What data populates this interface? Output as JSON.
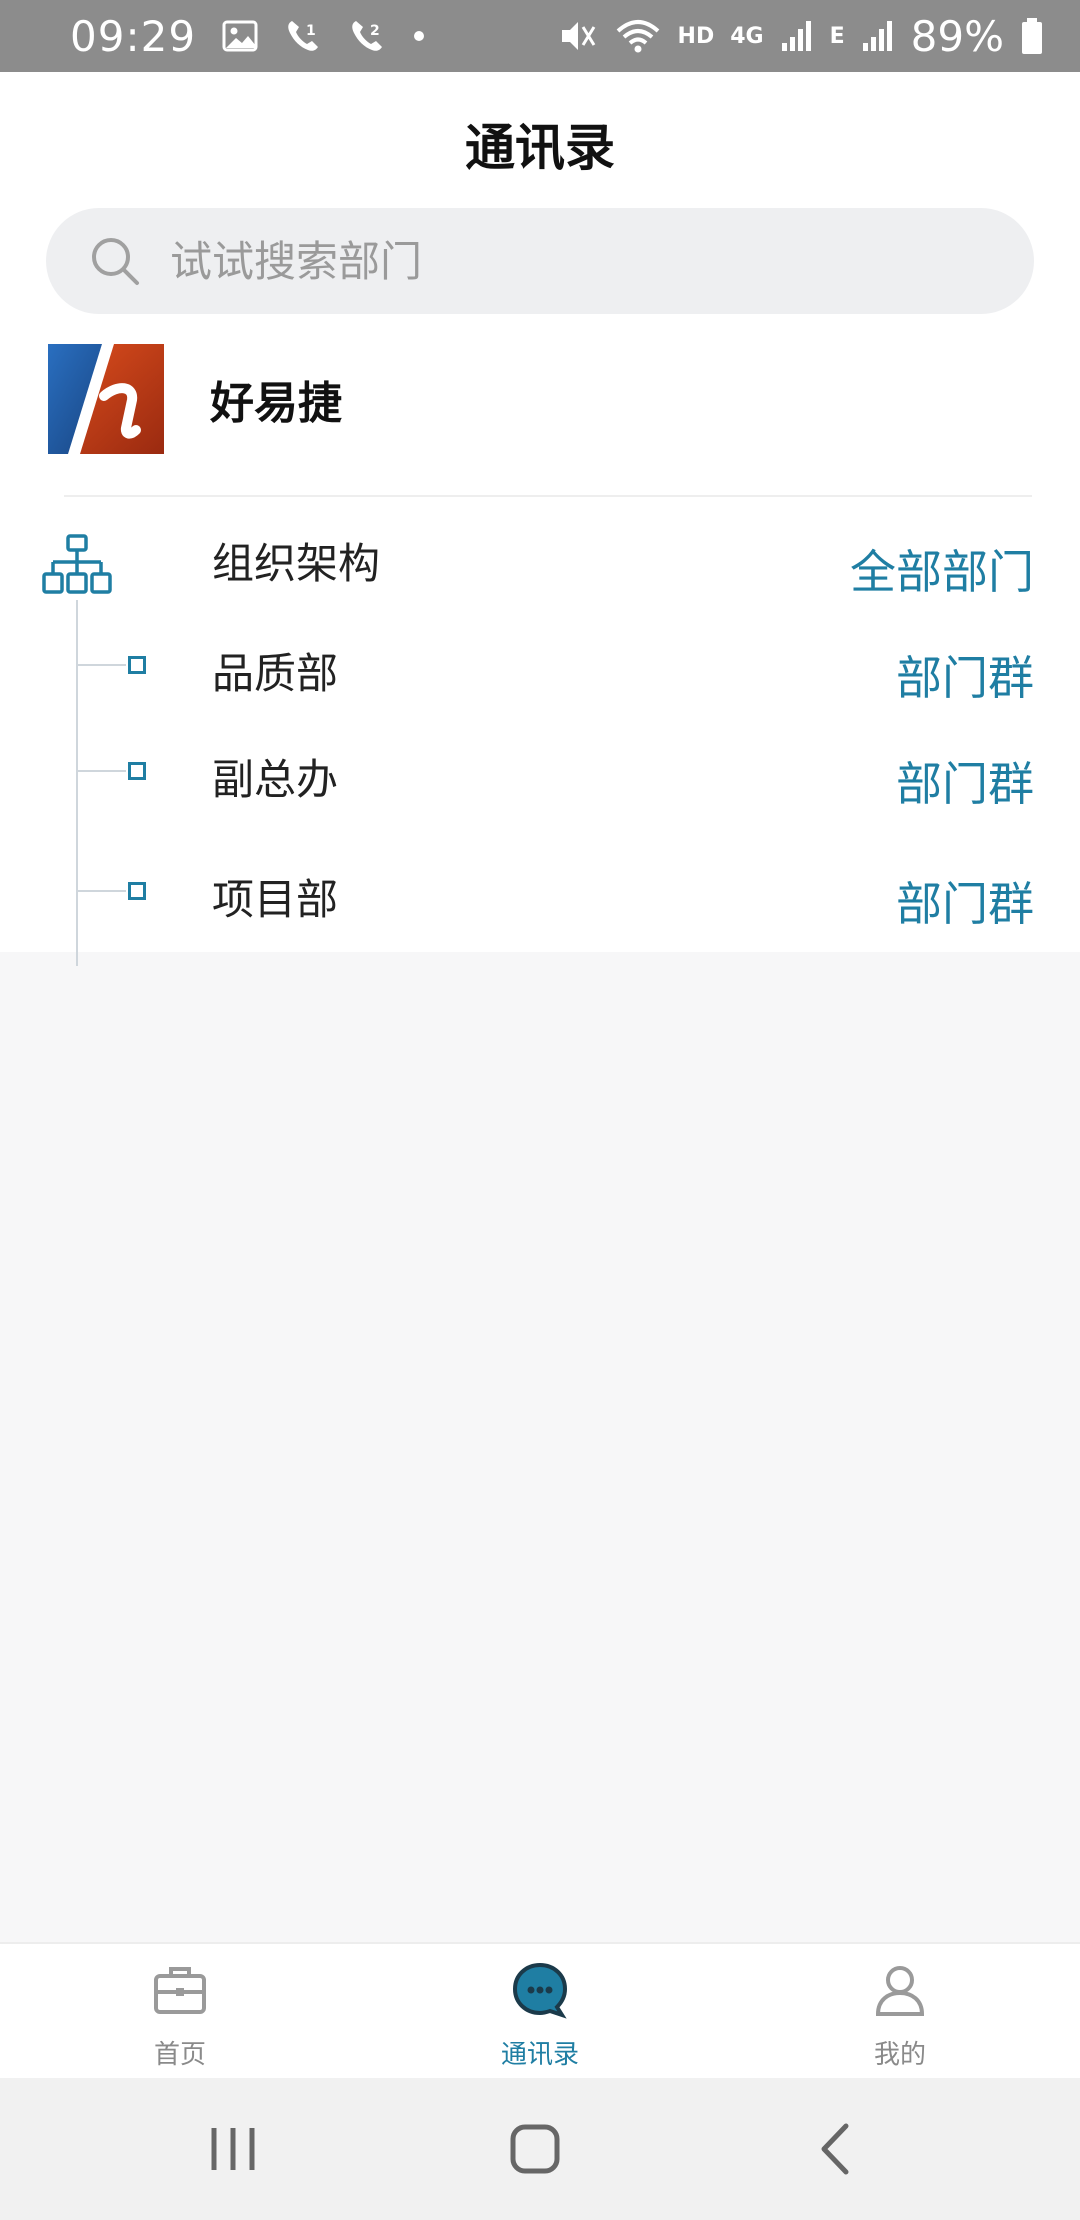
{
  "status_bar": {
    "time": "09:29",
    "network_label": "HD",
    "network_type": "4G",
    "network_sub": "E",
    "battery": "89%"
  },
  "page": {
    "title": "通讯录"
  },
  "search": {
    "placeholder": "试试搜索部门"
  },
  "company": {
    "name": "好易捷",
    "logo_letter": "h",
    "logo_colors": {
      "left": "#1f5aa6",
      "right": "#c8401a"
    }
  },
  "org": {
    "label": "组织架构",
    "all_link": "全部部门",
    "departments": [
      {
        "name": "品质部",
        "action": "部门群"
      },
      {
        "name": "副总办",
        "action": "部门群"
      },
      {
        "name": "项目部",
        "action": "部门群"
      }
    ]
  },
  "bottom_nav": {
    "items": [
      {
        "label": "首页",
        "icon": "briefcase-icon",
        "active": false
      },
      {
        "label": "通讯录",
        "icon": "chat-bubble-icon",
        "active": true
      },
      {
        "label": "我的",
        "icon": "user-icon",
        "active": false
      }
    ]
  },
  "colors": {
    "accent": "#1f7ea3",
    "status_bar": "#8c8c8c",
    "background": "#f7f7f8"
  }
}
